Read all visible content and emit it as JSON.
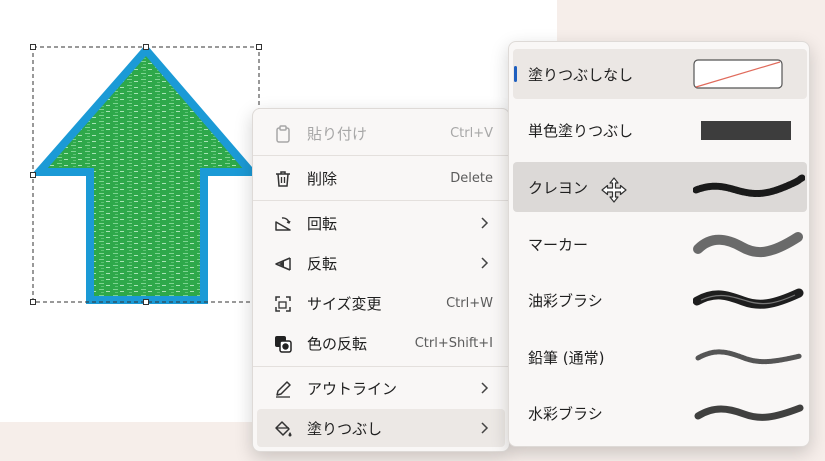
{
  "context_menu": {
    "items": [
      {
        "label": "貼り付け",
        "shortcut": "Ctrl+V",
        "icon": "clipboard-icon",
        "disabled": true
      },
      {
        "label": "削除",
        "shortcut": "Delete",
        "icon": "trash-icon"
      },
      {
        "label": "回転",
        "shortcut": "",
        "icon": "rotate-icon"
      },
      {
        "label": "反転",
        "shortcut": "",
        "icon": "flip-icon"
      },
      {
        "label": "サイズ変更",
        "shortcut": "Ctrl+W",
        "icon": "resize-icon"
      },
      {
        "label": "色の反転",
        "shortcut": "Ctrl+Shift+I",
        "icon": "invert-color-icon"
      },
      {
        "label": "アウトライン",
        "shortcut": "",
        "icon": "pen-outline-icon"
      },
      {
        "label": "塗りつぶし",
        "shortcut": "",
        "icon": "paint-bucket-icon"
      }
    ]
  },
  "fill_submenu": {
    "items": [
      {
        "label": "塗りつぶしなし",
        "preview": "none"
      },
      {
        "label": "単色塗りつぶし",
        "preview": "solid"
      },
      {
        "label": "クレヨン",
        "preview": "crayon"
      },
      {
        "label": "マーカー",
        "preview": "marker"
      },
      {
        "label": "油彩ブラシ",
        "preview": "oil"
      },
      {
        "label": "鉛筆 (通常)",
        "preview": "pencil"
      },
      {
        "label": "水彩ブラシ",
        "preview": "watercolor"
      }
    ],
    "selected": "塗りつぶしなし",
    "hovered": "クレヨン"
  },
  "colors": {
    "arrow_fill": "#2ea84a",
    "arrow_outline": "#1b9ad6",
    "selection_accent": "#1f5fbf"
  }
}
